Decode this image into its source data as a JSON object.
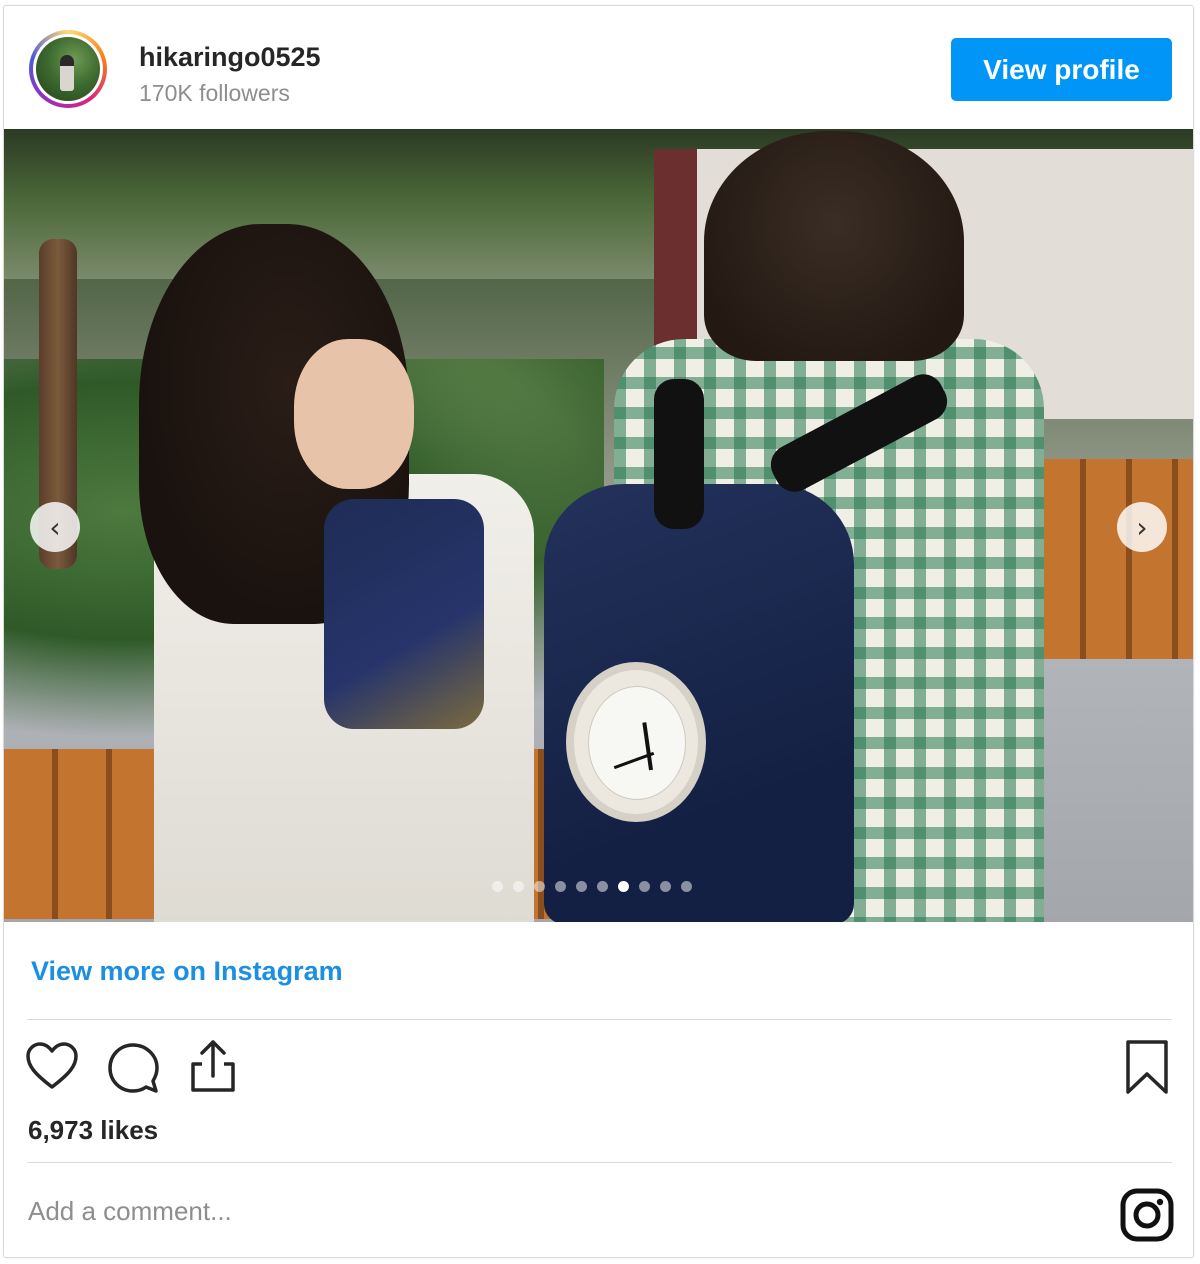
{
  "header": {
    "username": "hikaringo0525",
    "followers": "170K followers",
    "view_profile_label": "View profile"
  },
  "carousel": {
    "total_slides": 10,
    "active_slide": 6,
    "prev_icon": "chevron-left-icon",
    "next_icon": "chevron-right-icon"
  },
  "view_more_label": "View more on Instagram",
  "actions": {
    "icons": [
      "heart-icon",
      "comment-icon",
      "share-icon",
      "bookmark-icon"
    ],
    "likes": "6,973 likes"
  },
  "comment": {
    "placeholder": "Add a comment..."
  },
  "colors": {
    "accent": "#0095f6",
    "link": "#1c8fe0",
    "muted": "#8e8e8e",
    "text": "#262626"
  }
}
